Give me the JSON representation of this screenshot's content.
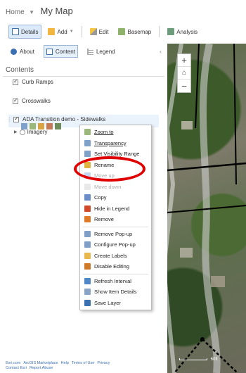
{
  "header": {
    "home": "Home",
    "title": "My Map"
  },
  "toolbar": {
    "details": "Details",
    "add": "Add",
    "edit": "Edit",
    "basemap": "Basemap",
    "analysis": "Analysis"
  },
  "tabs": {
    "about": "About",
    "content": "Content",
    "legend": "Legend"
  },
  "contents_heading": "Contents",
  "layers": [
    "Curb Ramps",
    "Crosswalks",
    "ADA Transition demo - Sidewalks",
    "Imagery"
  ],
  "menu": {
    "items": [
      "Zoom to",
      "Transparency",
      "Set Visibility Range",
      "Rename",
      "Move up",
      "Move down",
      "Copy",
      "Hide in Legend",
      "Remove",
      "Remove Pop-up",
      "Configure Pop-up",
      "Create Labels",
      "Disable Editing",
      "Refresh Interval",
      "Show Item Details",
      "Save Layer"
    ]
  },
  "footer": {
    "links": [
      "Esri.com",
      "ArcGIS Marketplace",
      "Help",
      "Terms of Use",
      "Privacy",
      "Contact Esri",
      "Report Abuse"
    ]
  },
  "map": {
    "zoom_in": "+",
    "zoom_out": "−",
    "scale_label": "60ft"
  },
  "colors": {
    "accent": "#3a6fb0",
    "highlight": "#e00000"
  }
}
